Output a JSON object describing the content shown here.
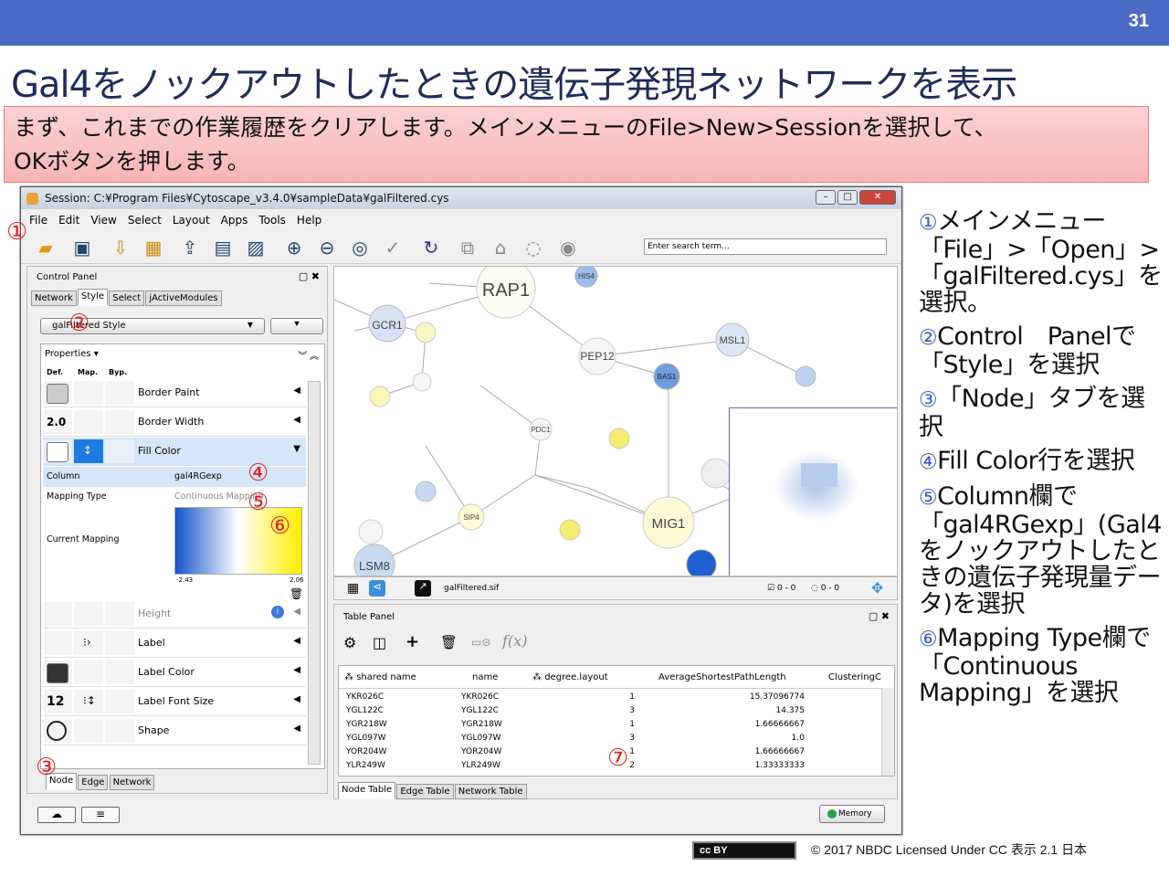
{
  "slide": {
    "number": "31",
    "title": "Gal4をノックアウトしたときの遺伝子発現ネットワークを表示",
    "instruction_line1": "まず、これまでの作業履歴をクリアします。メインメニューのFile>New>Sessionを選択して、",
    "instruction_line2": "OKボタンを押します。",
    "footer": "© 2017  NBDC Licensed Under CC 表示 2.1 日本",
    "cc_badge": "cc BY"
  },
  "window": {
    "title": "Session: C:¥Program Files¥Cytoscape_v3.4.0¥sampleData¥galFiltered.cys",
    "menu": [
      "File",
      "Edit",
      "View",
      "Select",
      "Layout",
      "Apps",
      "Tools",
      "Help"
    ],
    "search_placeholder": "Enter search term..."
  },
  "control_panel": {
    "title": "Control Panel",
    "tabs": [
      "Network",
      "Style",
      "Select",
      "jActiveModules"
    ],
    "style_name": "galFiltered Style",
    "properties_label": "Properties",
    "col_headers": [
      "Def.",
      "Map.",
      "Byp."
    ],
    "rows": [
      {
        "label": "Border Paint",
        "def": ""
      },
      {
        "label": "Border Width",
        "def": "2.0"
      },
      {
        "label": "Fill Color",
        "def": ""
      },
      {
        "label": "Height",
        "def": ""
      },
      {
        "label": "Label",
        "def": ""
      },
      {
        "label": "Label Color",
        "def": ""
      },
      {
        "label": "Label Font Size",
        "def": "12"
      },
      {
        "label": "Shape",
        "def": ""
      }
    ],
    "mapping": {
      "column_label": "Column",
      "column_value": "gal4RGexp",
      "type_label": "Mapping Type",
      "type_value": "Continuous Mapping",
      "current_label": "Current Mapping",
      "min": "-2.43",
      "max": "2.06"
    },
    "bottom_tabs": [
      "Node",
      "Edge",
      "Network"
    ]
  },
  "network": {
    "file": "galFiltered.sif",
    "sel_nodes": "0 - 0",
    "sel_edges": "0 - 0",
    "nodes": [
      {
        "l": "RAP1"
      },
      {
        "l": "GCR1"
      },
      {
        "l": "PEP12"
      },
      {
        "l": "MSL1"
      },
      {
        "l": "MIG1"
      },
      {
        "l": "LSM8"
      },
      {
        "l": "HIS4"
      },
      {
        "l": "PDC1"
      },
      {
        "l": "SIP4"
      },
      {
        "l": "BAS1"
      }
    ]
  },
  "table_panel": {
    "title": "Table Panel",
    "headers": [
      "shared name",
      "name",
      "degree.layout",
      "AverageShortestPathLength",
      "ClusteringC"
    ],
    "rows": [
      [
        "YKR026C",
        "YKR026C",
        "1",
        "15.37096774"
      ],
      [
        "YGL122C",
        "YGL122C",
        "3",
        "14.375"
      ],
      [
        "YGR218W",
        "YGR218W",
        "1",
        "1.66666667"
      ],
      [
        "YGL097W",
        "YGL097W",
        "3",
        "1.0"
      ],
      [
        "YOR204W",
        "YOR204W",
        "1",
        "1.66666667"
      ],
      [
        "YLR249W",
        "YLR249W",
        "2",
        "1.33333333"
      ]
    ],
    "tabs": [
      "Node Table",
      "Edge Table",
      "Network Table"
    ]
  },
  "memory_label": "Memory",
  "markers": [
    "①",
    "②",
    "③",
    "④",
    "⑤",
    "⑥",
    "⑦"
  ],
  "notes": [
    {
      "n": "①",
      "text": "メインメニュー「File」>「Open」>「galFiltered.cys」を選択。"
    },
    {
      "n": "②",
      "text": "Control　Panelで「Style」を選択"
    },
    {
      "n": "③",
      "text": "「Node」タブを選択"
    },
    {
      "n": "④",
      "text": "Fill Color行を選択"
    },
    {
      "n": "⑤",
      "text": "Column欄で「gal4RGexp」(Gal4をノックアウトしたときの遺伝子発現量データ)を選択"
    },
    {
      "n": "⑥",
      "text": "Mapping Type欄で「Continuous Mapping」を選択"
    }
  ]
}
